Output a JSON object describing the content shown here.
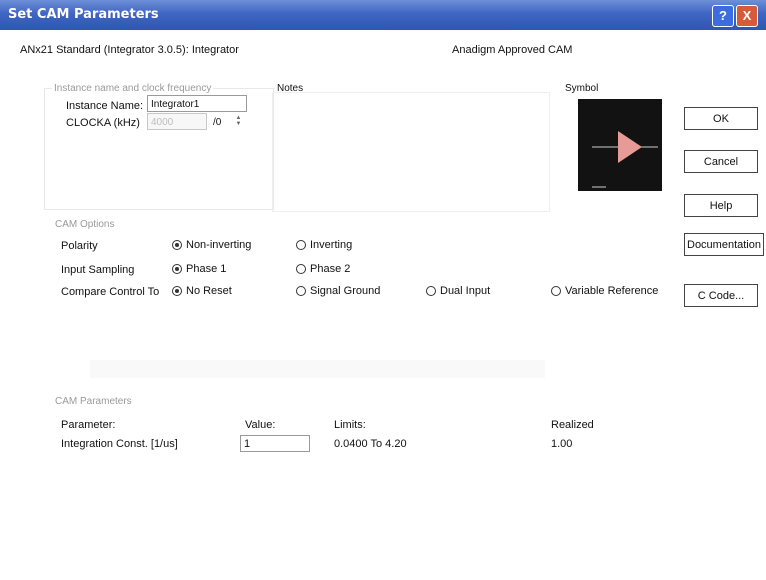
{
  "window": {
    "title": "Set CAM Parameters",
    "help_glyph": "?",
    "close_glyph": "X"
  },
  "header": {
    "cam_name": "ANx21 Standard (Integrator 3.0.5): Integrator",
    "approved": "Anadigm Approved CAM"
  },
  "instance_group": {
    "label": "Instance name and clock frequency",
    "name_label": "Instance Name:",
    "name_value": "Integrator1",
    "clock_label": "CLOCKA (kHz)",
    "clock_value": "4000",
    "divisor_value": "/0"
  },
  "notes": {
    "label": "Notes"
  },
  "symbol": {
    "label": "Symbol",
    "icon": "amplifier-triangle-icon",
    "triangle_color": "#e89a96"
  },
  "buttons": {
    "ok": "OK",
    "cancel": "Cancel",
    "help": "Help",
    "documentation": "Documentation",
    "ccode": "C Code..."
  },
  "cam_options": {
    "label": "CAM Options",
    "rows": [
      {
        "label": "Polarity",
        "options": [
          "Non-inverting",
          "Inverting"
        ],
        "selected": 0
      },
      {
        "label": "Input Sampling",
        "options": [
          "Phase 1",
          "Phase 2"
        ],
        "selected": 0
      },
      {
        "label": "Compare Control To",
        "options": [
          "No Reset",
          "Signal Ground",
          "Dual Input",
          "Variable Reference"
        ],
        "selected": 0
      }
    ]
  },
  "cam_parameters": {
    "label": "CAM Parameters",
    "headers": {
      "parameter": "Parameter:",
      "value": "Value:",
      "limits": "Limits:",
      "realized": "Realized"
    },
    "rows": [
      {
        "parameter": "Integration Const. [1/us]",
        "value": "1",
        "limits": "0.0400 To 4.20",
        "realized": "1.00"
      }
    ]
  }
}
